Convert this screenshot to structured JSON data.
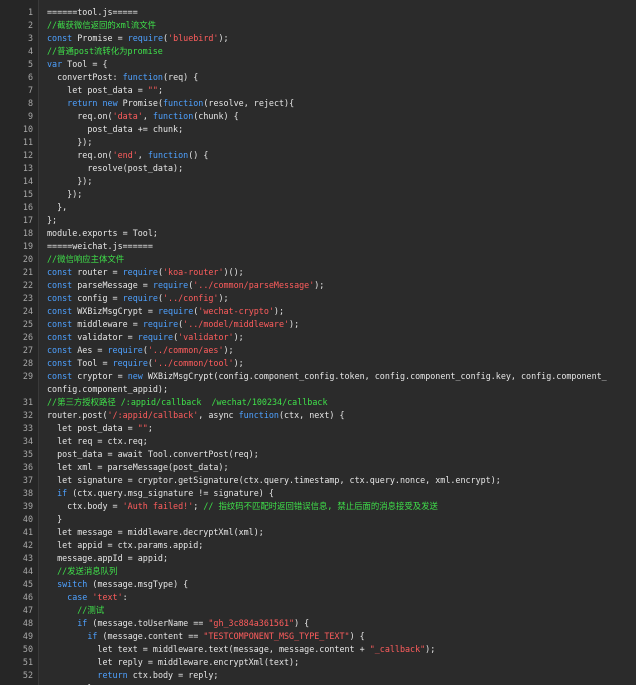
{
  "colors": {
    "background": "#2b2b2b",
    "gutter": "#262626",
    "line_number": "#a9a9a9",
    "plain": "#e6e6e6",
    "keyword": "#4ea1ff",
    "string": "#ff5d5d",
    "comment": "#3fe04a"
  },
  "lines": [
    {
      "n": "1",
      "tokens": [
        {
          "t": "======tool.js=====",
          "c": "plain"
        }
      ]
    },
    {
      "n": "2",
      "tokens": [
        {
          "t": "//截获微信返回的xml流文件",
          "c": "comment"
        }
      ]
    },
    {
      "n": "3",
      "tokens": [
        {
          "t": "const",
          "c": "keyword"
        },
        {
          "t": " Promise = ",
          "c": "plain"
        },
        {
          "t": "require",
          "c": "keyword"
        },
        {
          "t": "(",
          "c": "plain"
        },
        {
          "t": "'bluebird'",
          "c": "string"
        },
        {
          "t": ");",
          "c": "plain"
        }
      ]
    },
    {
      "n": "4",
      "tokens": [
        {
          "t": "//普通post流转化为promise",
          "c": "comment"
        }
      ]
    },
    {
      "n": "5",
      "tokens": [
        {
          "t": "var",
          "c": "keyword"
        },
        {
          "t": " Tool = {",
          "c": "plain"
        }
      ]
    },
    {
      "n": "6",
      "tokens": [
        {
          "t": "  convertPost: ",
          "c": "plain"
        },
        {
          "t": "function",
          "c": "keyword"
        },
        {
          "t": "(req) {",
          "c": "plain"
        }
      ]
    },
    {
      "n": "7",
      "tokens": [
        {
          "t": "    let post_data = ",
          "c": "plain"
        },
        {
          "t": "\"\"",
          "c": "string"
        },
        {
          "t": ";",
          "c": "plain"
        }
      ]
    },
    {
      "n": "8",
      "tokens": [
        {
          "t": "    ",
          "c": "plain"
        },
        {
          "t": "return",
          "c": "keyword"
        },
        {
          "t": " ",
          "c": "plain"
        },
        {
          "t": "new",
          "c": "keyword"
        },
        {
          "t": " Promise(",
          "c": "plain"
        },
        {
          "t": "function",
          "c": "keyword"
        },
        {
          "t": "(resolve, reject){",
          "c": "plain"
        }
      ]
    },
    {
      "n": "9",
      "tokens": [
        {
          "t": "      req.on(",
          "c": "plain"
        },
        {
          "t": "'data'",
          "c": "string"
        },
        {
          "t": ", ",
          "c": "plain"
        },
        {
          "t": "function",
          "c": "keyword"
        },
        {
          "t": "(chunk) {",
          "c": "plain"
        }
      ]
    },
    {
      "n": "10",
      "tokens": [
        {
          "t": "        post_data += chunk;",
          "c": "plain"
        }
      ]
    },
    {
      "n": "11",
      "tokens": [
        {
          "t": "      });",
          "c": "plain"
        }
      ]
    },
    {
      "n": "12",
      "tokens": [
        {
          "t": "      req.on(",
          "c": "plain"
        },
        {
          "t": "'end'",
          "c": "string"
        },
        {
          "t": ", ",
          "c": "plain"
        },
        {
          "t": "function",
          "c": "keyword"
        },
        {
          "t": "() {",
          "c": "plain"
        }
      ]
    },
    {
      "n": "13",
      "tokens": [
        {
          "t": "        resolve(post_data);",
          "c": "plain"
        }
      ]
    },
    {
      "n": "14",
      "tokens": [
        {
          "t": "      });",
          "c": "plain"
        }
      ]
    },
    {
      "n": "15",
      "tokens": [
        {
          "t": "    });",
          "c": "plain"
        }
      ]
    },
    {
      "n": "16",
      "tokens": [
        {
          "t": "  },",
          "c": "plain"
        }
      ]
    },
    {
      "n": "17",
      "tokens": [
        {
          "t": "};",
          "c": "plain"
        }
      ]
    },
    {
      "n": "18",
      "tokens": [
        {
          "t": "module.exports = Tool;",
          "c": "plain"
        }
      ]
    },
    {
      "n": "19",
      "tokens": [
        {
          "t": "=====weichat.js======",
          "c": "plain"
        }
      ]
    },
    {
      "n": "20",
      "tokens": [
        {
          "t": "//微信响应主体文件",
          "c": "comment"
        }
      ]
    },
    {
      "n": "21",
      "tokens": [
        {
          "t": "const",
          "c": "keyword"
        },
        {
          "t": " router = ",
          "c": "plain"
        },
        {
          "t": "require",
          "c": "keyword"
        },
        {
          "t": "(",
          "c": "plain"
        },
        {
          "t": "'koa-router'",
          "c": "string"
        },
        {
          "t": ")();",
          "c": "plain"
        }
      ]
    },
    {
      "n": "22",
      "tokens": [
        {
          "t": "const",
          "c": "keyword"
        },
        {
          "t": " parseMessage = ",
          "c": "plain"
        },
        {
          "t": "require",
          "c": "keyword"
        },
        {
          "t": "(",
          "c": "plain"
        },
        {
          "t": "'../common/parseMessage'",
          "c": "string"
        },
        {
          "t": ");",
          "c": "plain"
        }
      ]
    },
    {
      "n": "23",
      "tokens": [
        {
          "t": "const",
          "c": "keyword"
        },
        {
          "t": " config = ",
          "c": "plain"
        },
        {
          "t": "require",
          "c": "keyword"
        },
        {
          "t": "(",
          "c": "plain"
        },
        {
          "t": "'../config'",
          "c": "string"
        },
        {
          "t": ");",
          "c": "plain"
        }
      ]
    },
    {
      "n": "24",
      "tokens": [
        {
          "t": "const",
          "c": "keyword"
        },
        {
          "t": " WXBizMsgCrypt = ",
          "c": "plain"
        },
        {
          "t": "require",
          "c": "keyword"
        },
        {
          "t": "(",
          "c": "plain"
        },
        {
          "t": "'wechat-crypto'",
          "c": "string"
        },
        {
          "t": ");",
          "c": "plain"
        }
      ]
    },
    {
      "n": "25",
      "tokens": [
        {
          "t": "const",
          "c": "keyword"
        },
        {
          "t": " middleware = ",
          "c": "plain"
        },
        {
          "t": "require",
          "c": "keyword"
        },
        {
          "t": "(",
          "c": "plain"
        },
        {
          "t": "'../model/middleware'",
          "c": "string"
        },
        {
          "t": ");",
          "c": "plain"
        }
      ]
    },
    {
      "n": "26",
      "tokens": [
        {
          "t": "const",
          "c": "keyword"
        },
        {
          "t": " validator = ",
          "c": "plain"
        },
        {
          "t": "require",
          "c": "keyword"
        },
        {
          "t": "(",
          "c": "plain"
        },
        {
          "t": "'validator'",
          "c": "string"
        },
        {
          "t": ");",
          "c": "plain"
        }
      ]
    },
    {
      "n": "27",
      "tokens": [
        {
          "t": "const",
          "c": "keyword"
        },
        {
          "t": " Aes = ",
          "c": "plain"
        },
        {
          "t": "require",
          "c": "keyword"
        },
        {
          "t": "(",
          "c": "plain"
        },
        {
          "t": "'../common/aes'",
          "c": "string"
        },
        {
          "t": ");",
          "c": "plain"
        }
      ]
    },
    {
      "n": "28",
      "tokens": [
        {
          "t": "const",
          "c": "keyword"
        },
        {
          "t": " Tool = ",
          "c": "plain"
        },
        {
          "t": "require",
          "c": "keyword"
        },
        {
          "t": "(",
          "c": "plain"
        },
        {
          "t": "'../common/tool'",
          "c": "string"
        },
        {
          "t": ");",
          "c": "plain"
        }
      ]
    },
    {
      "n": "29",
      "tokens": [
        {
          "t": "const",
          "c": "keyword"
        },
        {
          "t": " cryptor = ",
          "c": "plain"
        },
        {
          "t": "new",
          "c": "keyword"
        },
        {
          "t": " WXBizMsgCrypt(config.component_config.token, config.component_config.key, config.component_",
          "c": "plain"
        }
      ]
    },
    {
      "n": "",
      "tokens": [
        {
          "t": "config.component_appid);",
          "c": "plain"
        }
      ]
    },
    {
      "n": "31",
      "tokens": [
        {
          "t": "//第三方授权路径 /:appid/callback  /wechat/100234/callback",
          "c": "comment"
        }
      ]
    },
    {
      "n": "32",
      "tokens": [
        {
          "t": "router.post(",
          "c": "plain"
        },
        {
          "t": "'/:appid/callback'",
          "c": "string"
        },
        {
          "t": ", async ",
          "c": "plain"
        },
        {
          "t": "function",
          "c": "keyword"
        },
        {
          "t": "(ctx, next) {",
          "c": "plain"
        }
      ]
    },
    {
      "n": "33",
      "tokens": [
        {
          "t": "  let post_data = ",
          "c": "plain"
        },
        {
          "t": "\"\"",
          "c": "string"
        },
        {
          "t": ";",
          "c": "plain"
        }
      ]
    },
    {
      "n": "34",
      "tokens": [
        {
          "t": "  let req = ctx.req;",
          "c": "plain"
        }
      ]
    },
    {
      "n": "35",
      "tokens": [
        {
          "t": "  post_data = await Tool.convertPost(req);",
          "c": "plain"
        }
      ]
    },
    {
      "n": "36",
      "tokens": [
        {
          "t": "  let xml = parseMessage(post_data);",
          "c": "plain"
        }
      ]
    },
    {
      "n": "37",
      "tokens": [
        {
          "t": "  let signature = cryptor.getSignature(ctx.query.timestamp, ctx.query.nonce, xml.encrypt);",
          "c": "plain"
        }
      ]
    },
    {
      "n": "38",
      "tokens": [
        {
          "t": "  ",
          "c": "plain"
        },
        {
          "t": "if",
          "c": "keyword"
        },
        {
          "t": " (ctx.query.msg_signature != signature) {",
          "c": "plain"
        }
      ]
    },
    {
      "n": "39",
      "tokens": [
        {
          "t": "    ctx.body = ",
          "c": "plain"
        },
        {
          "t": "'Auth failed!'",
          "c": "string"
        },
        {
          "t": "; ",
          "c": "plain"
        },
        {
          "t": "// 指纹码不匹配时返回错误信息, 禁止后面的消息接受及发送",
          "c": "comment"
        }
      ]
    },
    {
      "n": "40",
      "tokens": [
        {
          "t": "  }",
          "c": "plain"
        }
      ]
    },
    {
      "n": "41",
      "tokens": [
        {
          "t": "  let message = middleware.decryptXml(xml);",
          "c": "plain"
        }
      ]
    },
    {
      "n": "42",
      "tokens": [
        {
          "t": "  let appid = ctx.params.appid;",
          "c": "plain"
        }
      ]
    },
    {
      "n": "43",
      "tokens": [
        {
          "t": "  message.appId = appid;",
          "c": "plain"
        }
      ]
    },
    {
      "n": "44",
      "tokens": [
        {
          "t": "  ",
          "c": "plain"
        },
        {
          "t": "//发送消息队列",
          "c": "comment"
        }
      ]
    },
    {
      "n": "45",
      "tokens": [
        {
          "t": "  ",
          "c": "plain"
        },
        {
          "t": "switch",
          "c": "keyword"
        },
        {
          "t": " (message.msgType) {",
          "c": "plain"
        }
      ]
    },
    {
      "n": "46",
      "tokens": [
        {
          "t": "    ",
          "c": "plain"
        },
        {
          "t": "case",
          "c": "keyword"
        },
        {
          "t": " ",
          "c": "plain"
        },
        {
          "t": "'text'",
          "c": "string"
        },
        {
          "t": ":",
          "c": "plain"
        }
      ]
    },
    {
      "n": "47",
      "tokens": [
        {
          "t": "      ",
          "c": "plain"
        },
        {
          "t": "//测试",
          "c": "comment"
        }
      ]
    },
    {
      "n": "48",
      "tokens": [
        {
          "t": "      ",
          "c": "plain"
        },
        {
          "t": "if",
          "c": "keyword"
        },
        {
          "t": " (message.toUserName == ",
          "c": "plain"
        },
        {
          "t": "\"gh_3c884a361561\"",
          "c": "string"
        },
        {
          "t": ") {",
          "c": "plain"
        }
      ]
    },
    {
      "n": "49",
      "tokens": [
        {
          "t": "        ",
          "c": "plain"
        },
        {
          "t": "if",
          "c": "keyword"
        },
        {
          "t": " (message.content == ",
          "c": "plain"
        },
        {
          "t": "\"TESTCOMPONENT_MSG_TYPE_TEXT\"",
          "c": "string"
        },
        {
          "t": ") {",
          "c": "plain"
        }
      ]
    },
    {
      "n": "50",
      "tokens": [
        {
          "t": "          let text = middleware.text(message, message.content + ",
          "c": "plain"
        },
        {
          "t": "\"_callback\"",
          "c": "string"
        },
        {
          "t": ");",
          "c": "plain"
        }
      ]
    },
    {
      "n": "51",
      "tokens": [
        {
          "t": "          let reply = middleware.encryptXml(text);",
          "c": "plain"
        }
      ]
    },
    {
      "n": "52",
      "tokens": [
        {
          "t": "          ",
          "c": "plain"
        },
        {
          "t": "return",
          "c": "keyword"
        },
        {
          "t": " ctx.body = reply;",
          "c": "plain"
        }
      ]
    },
    {
      "n": "",
      "tokens": [
        {
          "t": "        }",
          "c": "plain"
        }
      ]
    }
  ]
}
